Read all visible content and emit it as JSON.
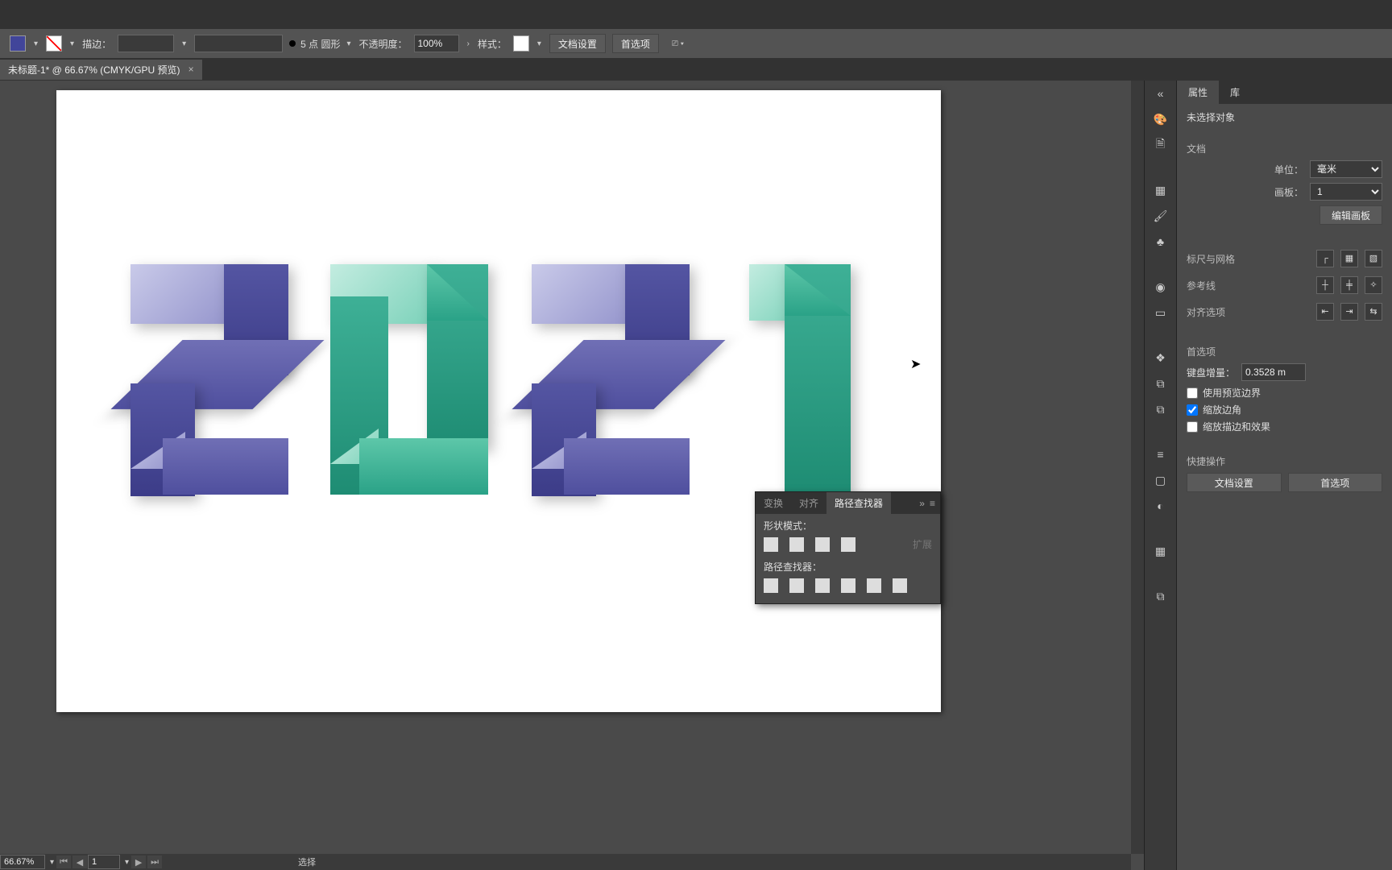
{
  "optbar": {
    "stroke_label": "描边：",
    "stroke_weight_display": "5 点 圆形",
    "opacity_label": "不透明度：",
    "opacity_value": "100%",
    "style_label": "样式：",
    "btn_doc_setup": "文档设置",
    "btn_prefs": "首选项"
  },
  "doc_tab": {
    "title": "未标题-1* @ 66.67% (CMYK/GPU 预览)",
    "close": "×"
  },
  "canvas": {
    "status": "选择"
  },
  "footer": {
    "zoom": "66.67%",
    "artboard_index": "1"
  },
  "iconcol": [
    "«",
    "palette-icon",
    "page-icon",
    "image-icon",
    "brush-icon",
    "club-icon",
    "circle-icon",
    "artboard-icon",
    "layers-icon",
    "clip-icon",
    "copy-icon",
    "lines-icon",
    "square-icon",
    "sphere-icon",
    "grid-icon",
    "overlap-icon"
  ],
  "props": {
    "tabs": {
      "properties": "属性",
      "library": "库"
    },
    "no_selection": "未选择对象",
    "section_doc": "文档",
    "unit_label": "单位：",
    "unit_value": "毫米",
    "artboard_label": "画板：",
    "artboard_value": "1",
    "btn_edit_artboards": "编辑画板",
    "section_rulers": "标尺与网格",
    "section_guides": "参考线",
    "section_align": "对齐选项",
    "section_prefs": "首选项",
    "key_increment_label": "键盘增量：",
    "key_increment_value": "0.3528 m",
    "chk_preview_bounds": "使用预览边界",
    "chk_scale_corners": "缩放边角",
    "chk_scale_strokes": "缩放描边和效果",
    "section_quick": "快捷操作",
    "btn_doc_setup": "文档设置",
    "btn_prefs": "首选项"
  },
  "pathfinder": {
    "tab_transform": "变换",
    "tab_align": "对齐",
    "tab_pathfinder": "路径查找器",
    "collapse": "»",
    "menu": "≡",
    "shape_modes_label": "形状模式：",
    "expand": "扩展",
    "pathfinders_label": "路径查找器："
  }
}
